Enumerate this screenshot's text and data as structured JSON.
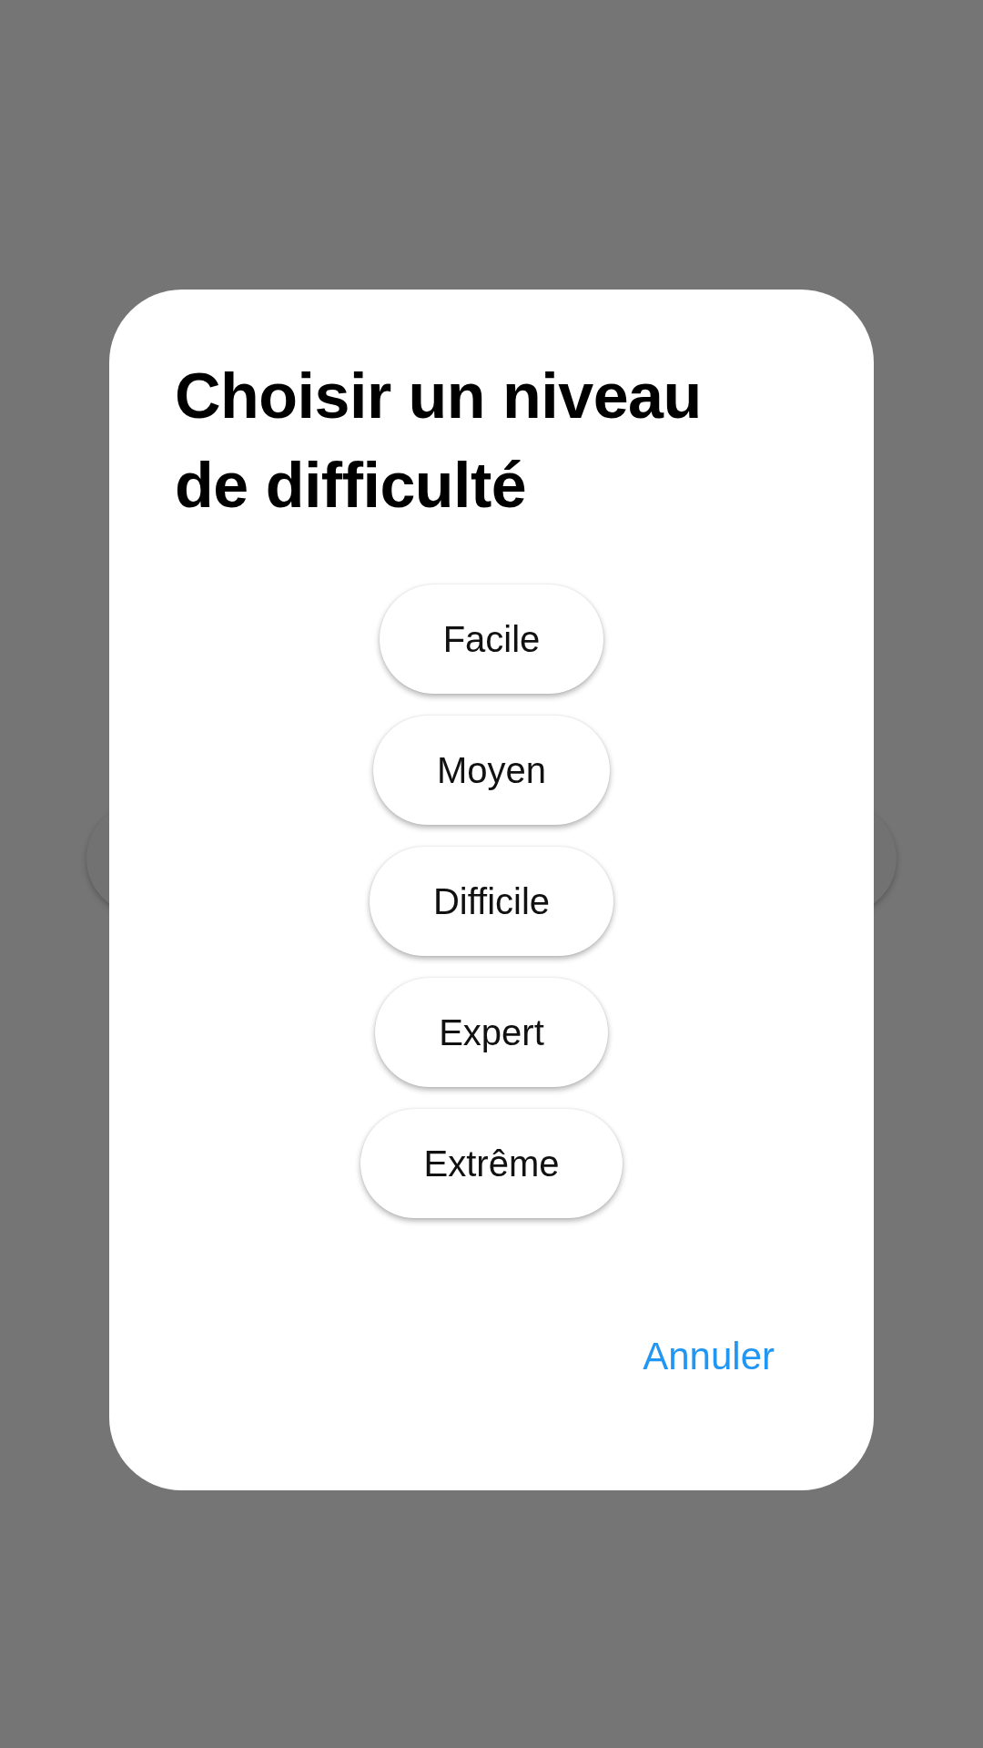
{
  "dialog": {
    "title": "Choisir un niveau de difficulté",
    "options": [
      {
        "label": "Facile"
      },
      {
        "label": "Moyen"
      },
      {
        "label": "Difficile"
      },
      {
        "label": "Expert"
      },
      {
        "label": "Extrême"
      }
    ],
    "actions": [
      {
        "label": "Annuler"
      }
    ]
  }
}
